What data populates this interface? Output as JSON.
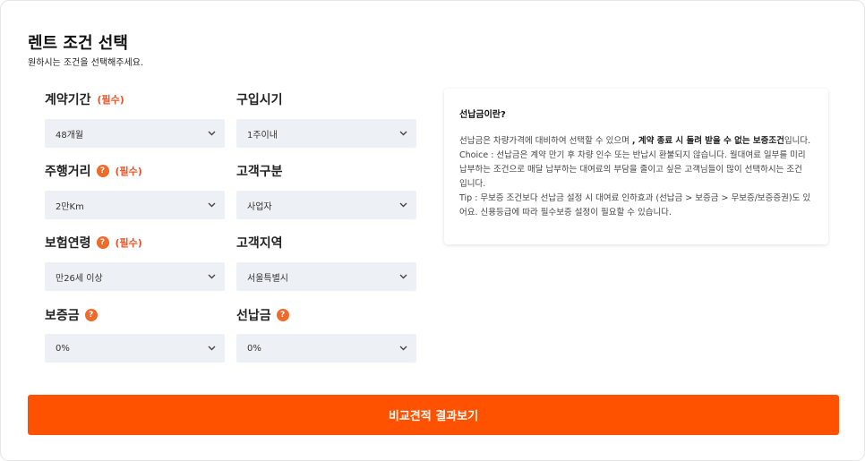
{
  "header": {
    "title": "렌트 조건 선택",
    "subtitle": "원하시는 조건을 선택해주세요."
  },
  "fields": {
    "contract_period": {
      "label": "계약기간",
      "required": "(필수)",
      "value": "48개월"
    },
    "purchase_time": {
      "label": "구입시기",
      "value": "1주이내"
    },
    "mileage": {
      "label": "주행거리",
      "required": "(필수)",
      "value": "2만Km",
      "help": "?"
    },
    "customer_type": {
      "label": "고객구분",
      "value": "사업자"
    },
    "insurance_age": {
      "label": "보험연령",
      "required": "(필수)",
      "value": "만26세 이상",
      "help": "?"
    },
    "customer_region": {
      "label": "고객지역",
      "value": "서울특별시"
    },
    "deposit": {
      "label": "보증금",
      "value": "0%",
      "help": "?"
    },
    "prepayment": {
      "label": "선납금",
      "value": "0%",
      "help": "?"
    }
  },
  "info": {
    "title": "선납금이란?",
    "p1_a": "선납금은 차량가격에 대비하여 선택할 수 있으며 ",
    "p1_b": ", 계약 종료 시 돌려 받을 수 없는 보증조건",
    "p1_c": "입니다.",
    "p2": "Choice : 선납금은 계약 만기 후 차량 인수 또는 반납시 환불되지 않습니다. 월대여료 일부를 미리 납부하는 조건으로 매달 납부하는 대여료의 부담을 줄이고 싶은 고객님들이 많이 선택하시는 조건 입니다.",
    "p3": "Tip : 무보증 조건보다 선납금 설정 시 대여료 인하효과 (선납금 > 보증금 > 무보증/보증증권)도 있어요. 신용등급에 따라 필수보증 설정이 필요할 수 있습니다."
  },
  "cta": {
    "label": "비교견적 결과보기"
  },
  "icons": {
    "dropdown": "chevron-down-icon",
    "help": "question-circle-icon"
  },
  "colors": {
    "accent": "#ff5200",
    "required": "#e8552b",
    "help": "#f06a2a",
    "select_bg": "#edf1f5"
  }
}
